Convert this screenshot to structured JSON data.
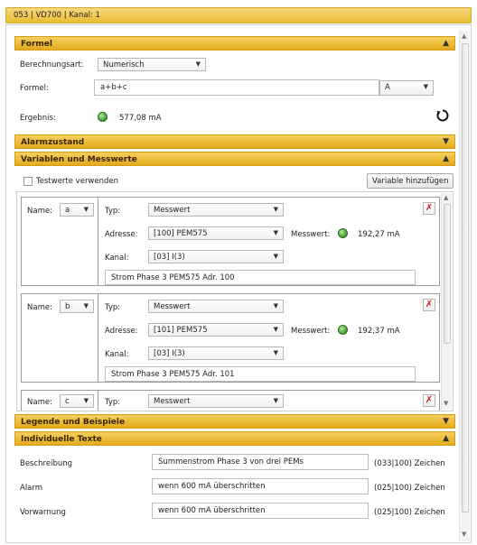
{
  "window": {
    "title": "053 | VD700 | Kanal: 1"
  },
  "sections": {
    "formel": "Formel",
    "alarmzustand": "Alarmzustand",
    "variablen": "Variablen und Messwerte",
    "legende": "Legende und Beispiele",
    "texte": "Individuelle Texte"
  },
  "formel": {
    "berechnungsart_label": "Berechnungsart:",
    "berechnungsart_value": "Numerisch",
    "formel_label": "Formel:",
    "formel_value": "a+b+c",
    "unit_value": "A",
    "ergebnis_label": "Ergebnis:",
    "ergebnis_value": "577,08 mA"
  },
  "variablen": {
    "testwerte_label": "Testwerte verwenden",
    "add_button": "Variable hinzufügen",
    "name_label": "Name:",
    "typ_label": "Typ:",
    "adresse_label": "Adresse:",
    "kanal_label": "Kanal:",
    "messwert_label": "Messwert:",
    "items": [
      {
        "name": "a",
        "typ": "Messwert",
        "adresse": "[100] PEM575",
        "kanal": "[03] I(3)",
        "messwert": "192,27 mA",
        "beschreibung": "Strom Phase 3 PEM575 Adr. 100"
      },
      {
        "name": "b",
        "typ": "Messwert",
        "adresse": "[101] PEM575",
        "kanal": "[03] I(3)",
        "messwert": "192,37 mA",
        "beschreibung": "Strom Phase 3 PEM575 Adr. 101"
      },
      {
        "name": "c",
        "typ": "Messwert"
      }
    ]
  },
  "texte": {
    "rows": [
      {
        "label": "Beschreibung",
        "value": "Summenstrom Phase 3 von drei PEMs",
        "count": "(033|100) Zeichen"
      },
      {
        "label": "Alarm",
        "value": "wenn 600 mA überschritten",
        "count": "(025|100) Zeichen"
      },
      {
        "label": "Vorwarnung",
        "value": "wenn 600 mA überschritten",
        "count": "(025|100) Zeichen"
      }
    ]
  },
  "icons": {
    "refresh": "refresh-icon",
    "delete": "delete-x-icon",
    "status_led": "status-led-icon",
    "chevron_up": "chevron-up-icon",
    "chevron_down": "chevron-down-icon",
    "dropdown_caret": "dropdown-caret-icon"
  },
  "colors": {
    "section_header": "#e8b327",
    "title_bar": "#f0c850",
    "led_ok": "#4ea53a",
    "delete_x": "#d21a1a"
  }
}
